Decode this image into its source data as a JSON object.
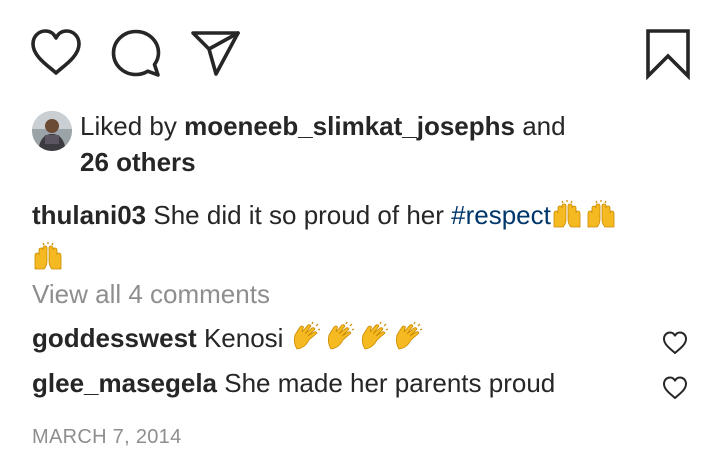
{
  "actions": {
    "like_icon": "heart-outline",
    "comment_icon": "speech-bubble",
    "share_icon": "paper-plane",
    "save_icon": "bookmark-outline"
  },
  "likes": {
    "prefix": "Liked by ",
    "user": "moeneeb_slimkat_josephs",
    "joiner": " and",
    "others": "26 others"
  },
  "caption": {
    "username": "thulani03",
    "text": "She did it so proud of her ",
    "hashtag": "#respect",
    "emoji": "raising-hands",
    "emoji_count": 3
  },
  "view_all": "View all 4 comments",
  "comments": [
    {
      "username": "goddesswest",
      "text": "Kenosi",
      "emoji": "clapping-hands",
      "emoji_count": 4
    },
    {
      "username": "glee_masegela",
      "text": "She made her parents proud"
    }
  ],
  "date": "MARCH 7, 2014",
  "colors": {
    "text": "#262626",
    "muted": "#8e8e8e",
    "hashtag": "#00376b",
    "emoji": "#f5b921"
  }
}
